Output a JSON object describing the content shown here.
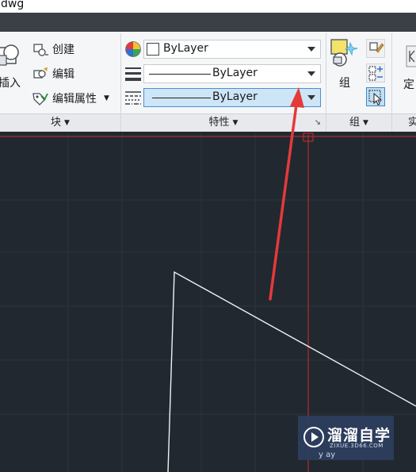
{
  "window": {
    "title": "dwg"
  },
  "ribbon": {
    "block_panel": {
      "insert_label": "插入",
      "create_label": "创建",
      "edit_label": "编辑",
      "edit_attributes_label": "编辑属性",
      "footer_label": "块"
    },
    "properties_panel": {
      "color_value": "ByLayer",
      "lineweight_value": "ByLayer",
      "linetype_value": "ByLayer",
      "footer_label": "特性"
    },
    "groups_panel": {
      "group_label": "组",
      "footer_label": "组"
    },
    "partial_panel": {
      "button_label": "定",
      "footer_label": "实"
    }
  },
  "watermark": {
    "title": "溜溜自学",
    "url": "ZIXUE.3D66.COM",
    "tail": "y  ay"
  },
  "colors": {
    "canvas_background": "#212830",
    "grid_line": "#2c343e",
    "crosshair": "#d42a2a",
    "drawing_line": "#f2f2f2",
    "annotation_arrow": "#e43a3a",
    "selected_combo": "#cde6f7"
  }
}
